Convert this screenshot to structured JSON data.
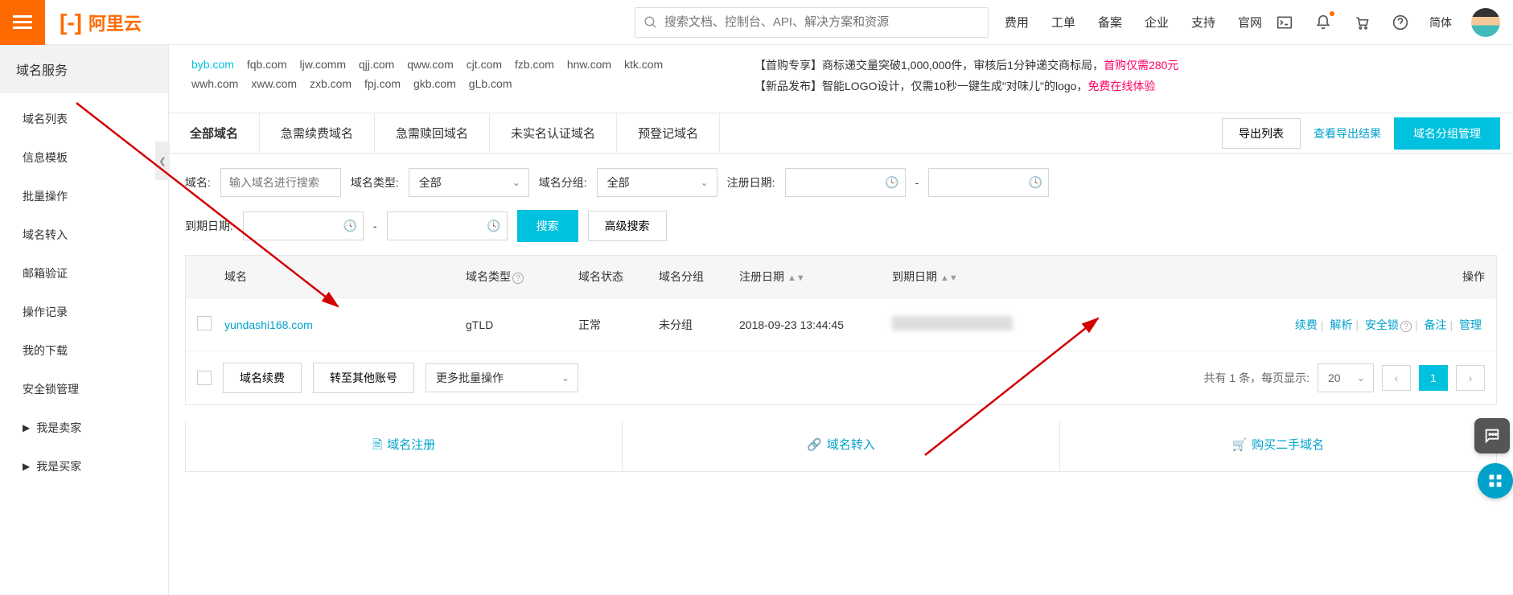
{
  "header": {
    "brand": "阿里云",
    "search_placeholder": "搜索文档、控制台、API、解决方案和资源",
    "nav": [
      "费用",
      "工单",
      "备案",
      "企业",
      "支持",
      "官网"
    ],
    "lang": "简体"
  },
  "sidebar": {
    "title": "域名服务",
    "items": [
      "域名列表",
      "信息模板",
      "批量操作",
      "域名转入",
      "邮箱验证",
      "操作记录",
      "我的下载",
      "安全锁管理",
      "我是卖家",
      "我是买家"
    ]
  },
  "promo": {
    "domains_hilite": "byb.com",
    "domains": [
      "fqb.com",
      "ljw.comm",
      "qjj.com",
      "qww.com",
      "cjt.com",
      "fzb.com",
      "hnw.com",
      "ktk.com",
      "wwh.com",
      "xww.com",
      "zxb.com",
      "fpj.com",
      "gkb.com",
      "gLb.com"
    ],
    "line1_pre": "【首购专享】商标递交量突破1,000,000件，审核后1分钟递交商标局，",
    "line1_pink": "首购仅需280元",
    "line2_pre": "【新品发布】智能LOGO设计，仅需10秒一键生成\"对味儿\"的logo，",
    "line2_pink": "免费在线体验"
  },
  "tabs": [
    "全部域名",
    "急需续费域名",
    "急需赎回域名",
    "未实名认证域名",
    "预登记域名"
  ],
  "actions": {
    "export": "导出列表",
    "view_export": "查看导出结果",
    "group_mgmt": "域名分组管理"
  },
  "filters": {
    "domain_label": "域名:",
    "domain_placeholder": "输入域名进行搜索",
    "type_label": "域名类型:",
    "type_value": "全部",
    "group_label": "域名分组:",
    "group_value": "全部",
    "reg_label": "注册日期:",
    "exp_label": "到期日期:",
    "search_btn": "搜索",
    "adv_btn": "高级搜索",
    "dash": "-"
  },
  "table": {
    "headers": {
      "domain": "域名",
      "type": "域名类型",
      "status": "域名状态",
      "group": "域名分组",
      "reg": "注册日期",
      "exp": "到期日期",
      "ops": "操作"
    },
    "row": {
      "domain": "yundashi168.com",
      "type": "gTLD",
      "status": "正常",
      "group": "未分组",
      "reg": "2018-09-23 13:44:45",
      "ops": {
        "renew": "续费",
        "parse": "解析",
        "lock": "安全锁",
        "remark": "备注",
        "manage": "管理"
      }
    }
  },
  "batch": {
    "renew": "域名续费",
    "transfer": "转至其他账号",
    "more": "更多批量操作",
    "total_pre": "共有 1 条，每页显示:",
    "page_size": "20",
    "page": "1"
  },
  "bottom": {
    "register": "域名注册",
    "transfer_in": "域名转入",
    "buy_used": "购买二手域名"
  }
}
